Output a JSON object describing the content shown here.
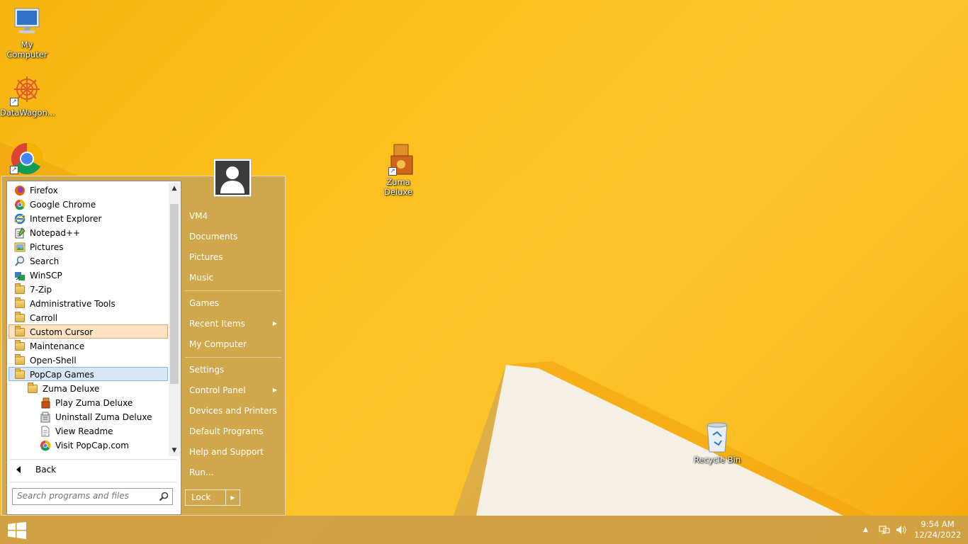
{
  "desktop": {
    "icons": [
      {
        "label": "My\nComputer",
        "icon": "monitor-icon"
      },
      {
        "label": "DataWagon...",
        "icon": "datawagon-icon"
      },
      {
        "label": "",
        "icon": "chrome-icon"
      },
      {
        "label": "Zuma Deluxe",
        "icon": "zuma-icon"
      },
      {
        "label": "Recycle Bin",
        "icon": "recycle-bin-icon"
      }
    ]
  },
  "start_menu": {
    "programs": [
      {
        "label": "Firefox",
        "icon": "firefox-icon"
      },
      {
        "label": "Google Chrome",
        "icon": "chrome-icon"
      },
      {
        "label": "Internet Explorer",
        "icon": "ie-icon"
      },
      {
        "label": "Notepad++",
        "icon": "notepadpp-icon"
      },
      {
        "label": "Pictures",
        "icon": "pictures-icon"
      },
      {
        "label": "Search",
        "icon": "search-icon"
      },
      {
        "label": "WinSCP",
        "icon": "winscp-icon"
      },
      {
        "label": "7-Zip",
        "icon": "folder-icon"
      },
      {
        "label": "Administrative Tools",
        "icon": "folder-icon"
      },
      {
        "label": "Carroll",
        "icon": "folder-icon"
      },
      {
        "label": "Custom Cursor",
        "icon": "folder-icon"
      },
      {
        "label": "Maintenance",
        "icon": "folder-icon"
      },
      {
        "label": "Open-Shell",
        "icon": "folder-icon"
      },
      {
        "label": "PopCap Games",
        "icon": "folder-icon"
      },
      {
        "label": "Zuma Deluxe",
        "icon": "folder-icon"
      },
      {
        "label": "Play Zuma Deluxe",
        "icon": "zuma-icon"
      },
      {
        "label": "Uninstall Zuma Deluxe",
        "icon": "uninstall-icon"
      },
      {
        "label": "View Readme",
        "icon": "document-icon"
      },
      {
        "label": "Visit PopCap.com",
        "icon": "chrome-icon"
      }
    ],
    "back_label": "Back",
    "search_placeholder": "Search programs and files",
    "right_items": [
      {
        "label": "VM4",
        "submenu": false
      },
      {
        "label": "Documents",
        "submenu": false
      },
      {
        "label": "Pictures",
        "submenu": false
      },
      {
        "label": "Music",
        "submenu": false
      },
      {
        "label": "Games",
        "submenu": false
      },
      {
        "label": "Recent Items",
        "submenu": true
      },
      {
        "label": "My Computer",
        "submenu": false
      },
      {
        "label": "Settings",
        "submenu": false
      },
      {
        "label": "Control Panel",
        "submenu": true
      },
      {
        "label": "Devices and Printers",
        "submenu": false
      },
      {
        "label": "Default Programs",
        "submenu": false
      },
      {
        "label": "Help and Support",
        "submenu": false
      },
      {
        "label": "Run...",
        "submenu": false
      }
    ],
    "lock_label": "Lock"
  },
  "taskbar": {
    "time": "9:54 AM",
    "date": "12/24/2022"
  }
}
